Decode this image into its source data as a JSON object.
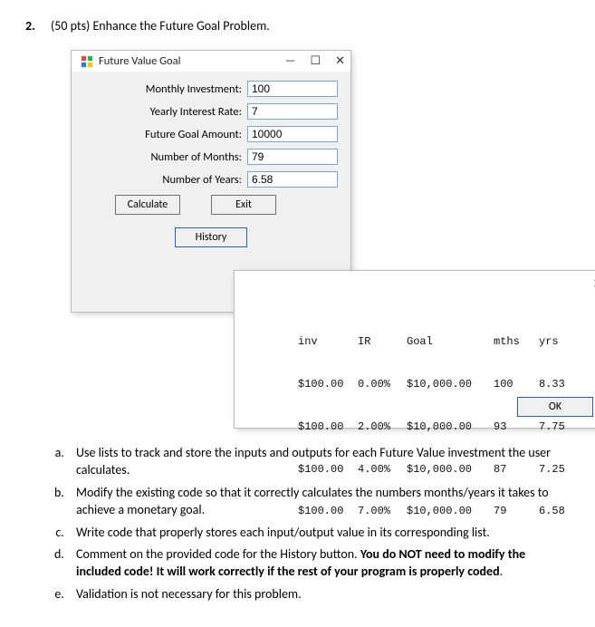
{
  "problem": {
    "number": "2.",
    "prompt": "(50 pts) Enhance the Future Goal Problem."
  },
  "main_window": {
    "title": "Future Value Goal",
    "min_icon": "—",
    "max_icon": "☐",
    "close_icon": "✕",
    "fields": {
      "monthly_investment": {
        "label": "Monthly Investment:",
        "value": "100"
      },
      "yearly_interest_rate": {
        "label": "Yearly Interest Rate:",
        "value": "7"
      },
      "future_goal_amount": {
        "label": "Future Goal Amount:",
        "value": "10000"
      },
      "number_of_months": {
        "label": "Number of Months:",
        "value": "79"
      },
      "number_of_years": {
        "label": "Number of Years:",
        "value": "6.58"
      }
    },
    "buttons": {
      "calculate": "Calculate",
      "exit": "Exit",
      "history": "History"
    }
  },
  "dialog": {
    "close_icon": "✕",
    "ok_label": "OK",
    "headers": {
      "inv": "inv",
      "ir": "IR",
      "goal": "Goal",
      "mths": "mths",
      "yrs": "yrs"
    },
    "rows": [
      {
        "inv": "$100.00",
        "ir": "0.00%",
        "goal": "$10,000.00",
        "mths": "100",
        "yrs": "8.33"
      },
      {
        "inv": "$100.00",
        "ir": "2.00%",
        "goal": "$10,000.00",
        "mths": "93",
        "yrs": "7.75"
      },
      {
        "inv": "$100.00",
        "ir": "4.00%",
        "goal": "$10,000.00",
        "mths": "87",
        "yrs": "7.25"
      },
      {
        "inv": "$100.00",
        "ir": "7.00%",
        "goal": "$10,000.00",
        "mths": "79",
        "yrs": "6.58"
      }
    ]
  },
  "subitems": {
    "a": "Use lists to track and store the inputs and outputs for each Future Value investment the user calculates.",
    "b": "Modify the existing code so that it correctly calculates the numbers months/years it takes to achieve a monetary goal.",
    "c": "Write code that properly stores each input/output value in its corresponding list.",
    "d_pre": "Comment on the provided code for the History button. ",
    "d_bold": "You do NOT need to modify the included code! It will work correctly if the rest of your program is properly coded",
    "d_post": ".",
    "e": "Validation is not necessary for this problem."
  }
}
